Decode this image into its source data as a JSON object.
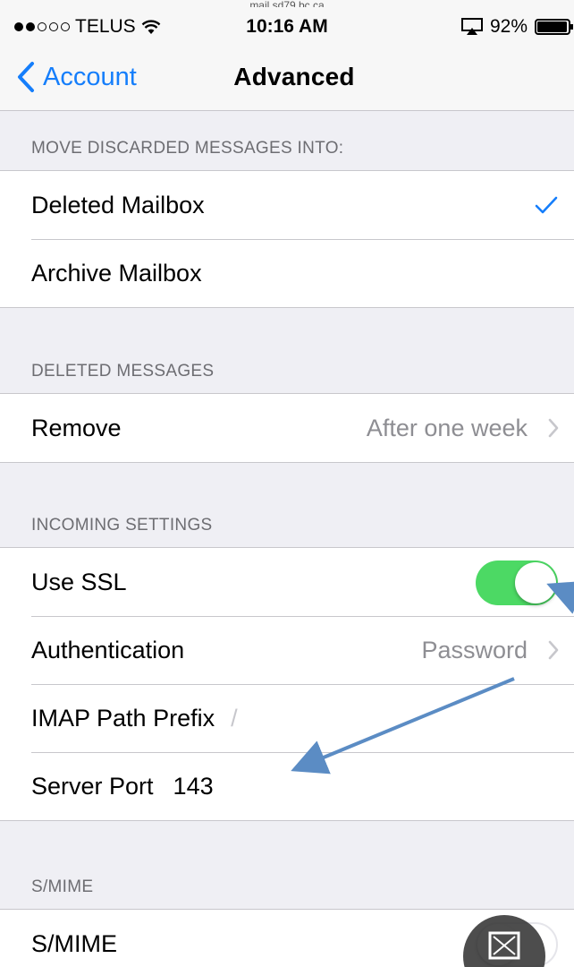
{
  "url_snippet": "mail.sd79.bc.ca",
  "status_bar": {
    "carrier": "TELUS",
    "time": "10:16 AM",
    "battery_percent": "92%",
    "signal_bars_filled": 2,
    "signal_bars_total": 5,
    "icons": [
      "wifi-icon",
      "airplay-icon",
      "battery-icon"
    ]
  },
  "nav": {
    "back_label": "Account",
    "title": "Advanced"
  },
  "sections": {
    "discarded": {
      "header": "MOVE DISCARDED MESSAGES INTO:",
      "items": [
        {
          "label": "Deleted Mailbox",
          "checked": true
        },
        {
          "label": "Archive Mailbox",
          "checked": false
        }
      ]
    },
    "deleted": {
      "header": "DELETED MESSAGES",
      "remove_label": "Remove",
      "remove_value": "After one week"
    },
    "incoming": {
      "header": "INCOMING SETTINGS",
      "ssl_label": "Use SSL",
      "ssl_on": true,
      "auth_label": "Authentication",
      "auth_value": "Password",
      "imap_label": "IMAP Path Prefix",
      "imap_value": "/",
      "port_label": "Server Port",
      "port_value": "143"
    },
    "smime": {
      "header": "S/MIME",
      "label": "S/MIME",
      "on": false
    }
  },
  "colors": {
    "accent": "#157efb",
    "toggle_on": "#4cd964",
    "background": "#efeff4",
    "annotation_arrow": "#5b8cc4"
  }
}
